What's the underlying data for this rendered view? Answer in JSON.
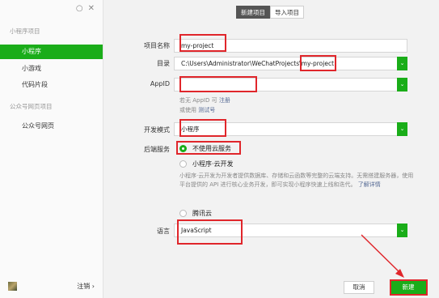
{
  "sidebar": {
    "window_controls": [
      "○",
      "✕"
    ],
    "sections": [
      {
        "title": "小程序项目",
        "items": [
          "小程序",
          "小游戏",
          "代码片段"
        ]
      },
      {
        "title": "公众号网页项目",
        "items": [
          "公众号网页"
        ]
      }
    ],
    "active_item": "小程序",
    "logout": "注销 ›"
  },
  "tabs": [
    "新建项目",
    "导入项目"
  ],
  "form": {
    "project_name": {
      "label": "项目名称",
      "value": "my-project"
    },
    "directory": {
      "label": "目录",
      "value": "C:\\Users\\Administrator\\WeChatProjects\\my-project"
    },
    "appid": {
      "label": "AppID",
      "value": "",
      "note_line1_prefix": "若无 AppID 可",
      "note_register": "注册",
      "note_line2_prefix": "或使用",
      "note_test": "测试号"
    },
    "dev_mode": {
      "label": "开发模式",
      "value": "小程序"
    },
    "backend": {
      "label": "后端服务",
      "option_none": "不使用云服务",
      "option_cloud": "小程序·云开发",
      "cloud_desc": "小程序·云开发为开发者提供数据库、存储和云函数等完整的云端支持。无需搭建服务器，使用平台提供的 API 进行核心业务开发，即可实现小程序快速上线和迭代。",
      "cloud_link": "了解详情",
      "option_tencent": "腾讯云"
    },
    "language": {
      "label": "语言",
      "value": "JavaScript"
    }
  },
  "buttons": {
    "cancel": "取消",
    "create": "新建"
  },
  "colors": {
    "accent": "#1aad19",
    "annotation": "#e0262b"
  }
}
